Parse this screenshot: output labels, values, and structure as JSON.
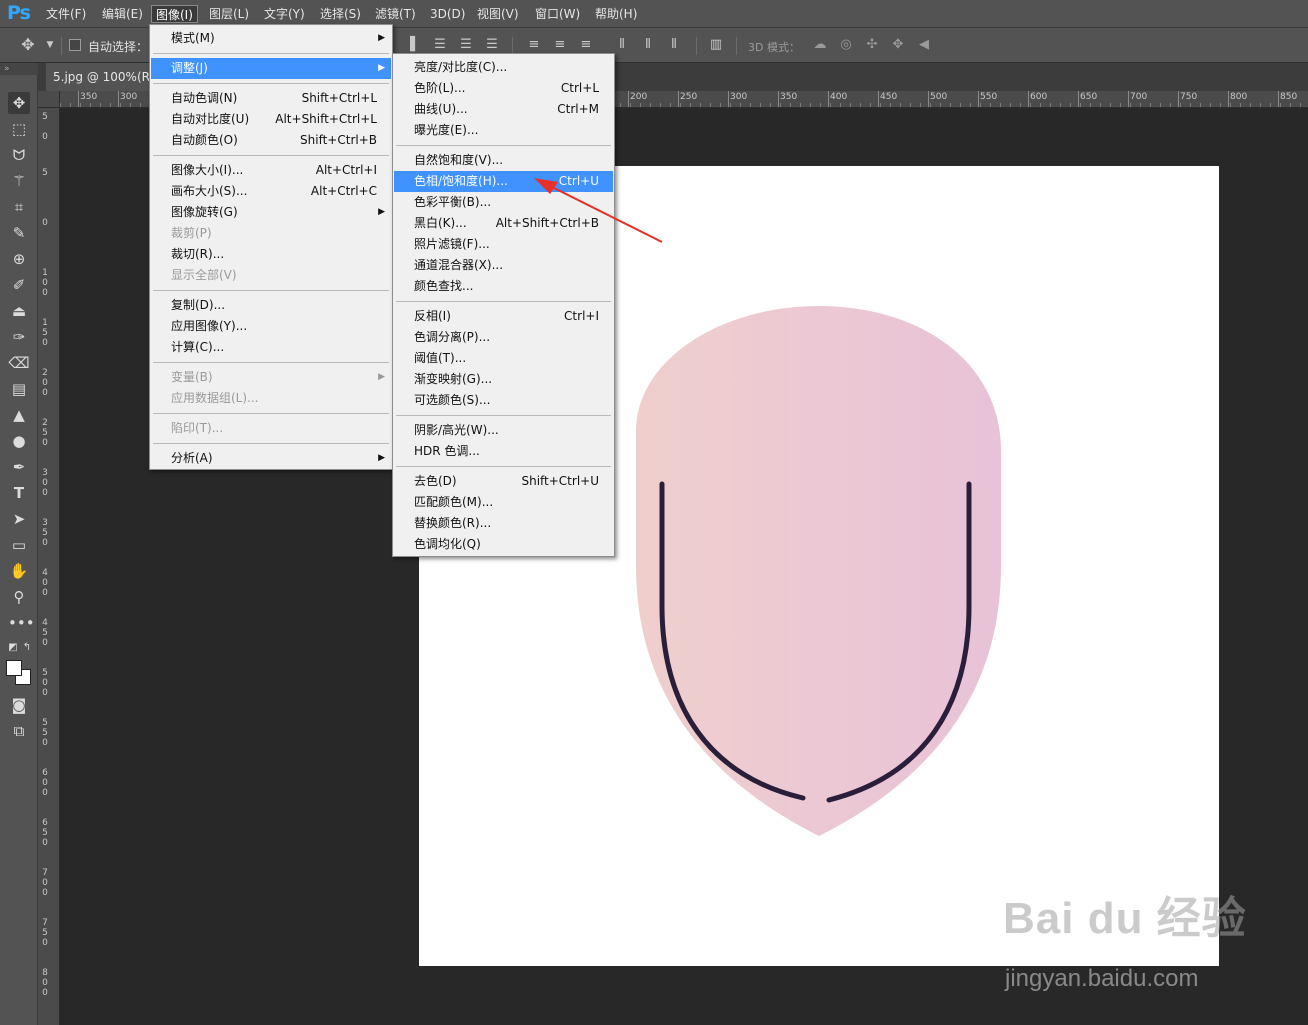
{
  "app": {
    "logo": "Ps"
  },
  "menubar": [
    {
      "label": "文件(F)"
    },
    {
      "label": "编辑(E)"
    },
    {
      "label": "图像(I)"
    },
    {
      "label": "图层(L)"
    },
    {
      "label": "文字(Y)"
    },
    {
      "label": "选择(S)"
    },
    {
      "label": "滤镜(T)"
    },
    {
      "label": "3D(D)"
    },
    {
      "label": "视图(V)"
    },
    {
      "label": "窗口(W)"
    },
    {
      "label": "帮助(H)"
    }
  ],
  "options": {
    "auto_select": "自动选择：",
    "mode_3d": "3D 模式："
  },
  "document": {
    "tab": "5.jpg @ 100%(RGB"
  },
  "ruler_top": [
    "350",
    "300",
    "200",
    "250",
    "300",
    "350",
    "400",
    "450",
    "500",
    "550",
    "600",
    "650",
    "700",
    "750",
    "800",
    "850"
  ],
  "ruler_left": [
    "5",
    "0",
    "5",
    "0",
    "1\n0\n0",
    "1\n5\n0",
    "2\n0\n0",
    "2\n5\n0",
    "3\n0\n0",
    "3\n5\n0",
    "4\n0\n0",
    "4\n5\n0",
    "5\n0\n0",
    "5\n5\n0",
    "6\n0\n0",
    "6\n5\n0",
    "7\n0\n0",
    "7\n5\n0",
    "8\n0\n0"
  ],
  "image_menu": {
    "items": [
      {
        "label": "模式(M)",
        "submenu": true
      },
      {
        "label": "调整(J)",
        "submenu": true,
        "highlight": true
      },
      {
        "label": "自动色调(N)",
        "shortcut": "Shift+Ctrl+L"
      },
      {
        "label": "自动对比度(U)",
        "shortcut": "Alt+Shift+Ctrl+L"
      },
      {
        "label": "自动颜色(O)",
        "shortcut": "Shift+Ctrl+B"
      },
      {
        "label": "图像大小(I)...",
        "shortcut": "Alt+Ctrl+I"
      },
      {
        "label": "画布大小(S)...",
        "shortcut": "Alt+Ctrl+C"
      },
      {
        "label": "图像旋转(G)",
        "submenu": true
      },
      {
        "label": "裁剪(P)",
        "disabled": true
      },
      {
        "label": "裁切(R)..."
      },
      {
        "label": "显示全部(V)",
        "disabled": true
      },
      {
        "label": "复制(D)..."
      },
      {
        "label": "应用图像(Y)..."
      },
      {
        "label": "计算(C)..."
      },
      {
        "label": "变量(B)",
        "submenu": true,
        "disabled": true
      },
      {
        "label": "应用数据组(L)...",
        "disabled": true
      },
      {
        "label": "陷印(T)...",
        "disabled": true
      },
      {
        "label": "分析(A)",
        "submenu": true
      }
    ]
  },
  "adjust_menu": {
    "items": [
      {
        "label": "亮度/对比度(C)..."
      },
      {
        "label": "色阶(L)...",
        "shortcut": "Ctrl+L"
      },
      {
        "label": "曲线(U)...",
        "shortcut": "Ctrl+M"
      },
      {
        "label": "曝光度(E)..."
      },
      {
        "label": "自然饱和度(V)..."
      },
      {
        "label": "色相/饱和度(H)...",
        "shortcut": "Ctrl+U",
        "highlight": true
      },
      {
        "label": "色彩平衡(B)..."
      },
      {
        "label": "黑白(K)...",
        "shortcut": "Alt+Shift+Ctrl+B"
      },
      {
        "label": "照片滤镜(F)..."
      },
      {
        "label": "通道混合器(X)..."
      },
      {
        "label": "颜色查找..."
      },
      {
        "label": "反相(I)",
        "shortcut": "Ctrl+I"
      },
      {
        "label": "色调分离(P)..."
      },
      {
        "label": "阈值(T)..."
      },
      {
        "label": "渐变映射(G)..."
      },
      {
        "label": "可选颜色(S)..."
      },
      {
        "label": "阴影/高光(W)..."
      },
      {
        "label": "HDR 色调..."
      },
      {
        "label": "去色(D)",
        "shortcut": "Shift+Ctrl+U"
      },
      {
        "label": "匹配颜色(M)..."
      },
      {
        "label": "替换颜色(R)..."
      },
      {
        "label": "色调均化(Q)"
      }
    ]
  },
  "watermark": {
    "logo": "Bai du 经验",
    "url": "jingyan.baidu.com"
  },
  "colors": {
    "highlight": "#3f92ff",
    "annotation_arrow": "#e8302a",
    "object_pink": "#eccbd3",
    "object_line": "#2a1f3a"
  }
}
